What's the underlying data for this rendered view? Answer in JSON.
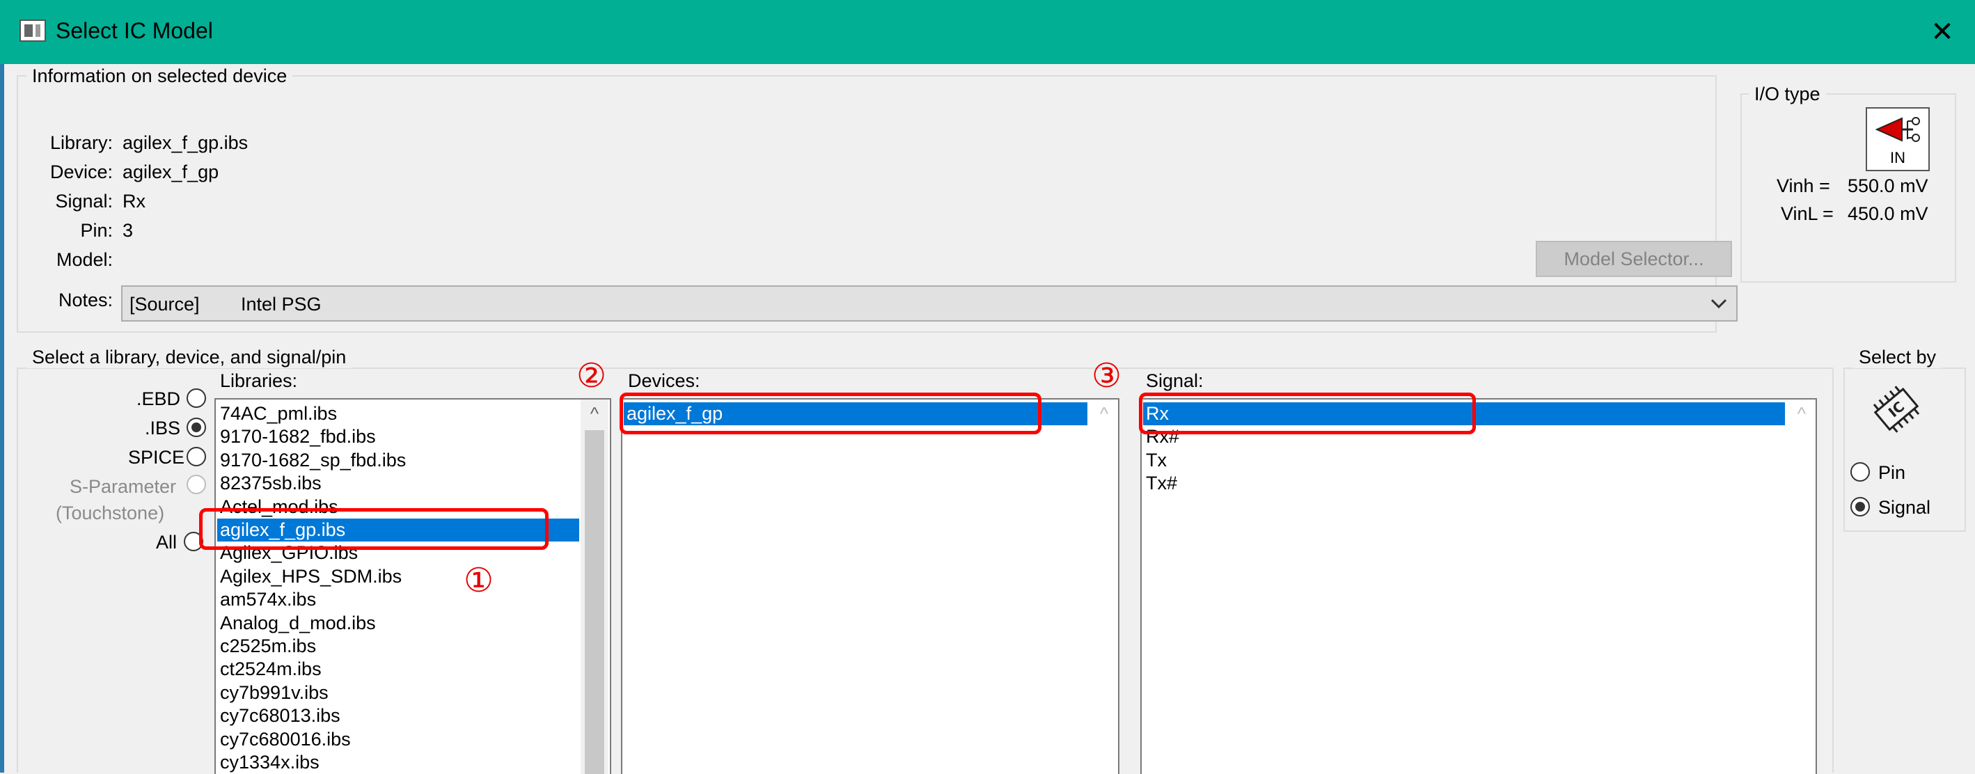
{
  "window": {
    "title": "Select IC Model",
    "close_glyph": "✕"
  },
  "info": {
    "group_title": "Information on selected device",
    "library_label": "Library:",
    "library_value": "agilex_f_gp.ibs",
    "device_label": "Device:",
    "device_value": "agilex_f_gp",
    "signal_label": "Signal:",
    "signal_value": "Rx",
    "pin_label": "Pin:",
    "pin_value": "3",
    "model_label": "Model:",
    "model_value": "",
    "notes_label": "Notes:",
    "notes_value_source": "[Source]",
    "notes_value_text": "Intel PSG",
    "model_selector_label": "Model Selector..."
  },
  "io_type": {
    "group_title": "I/O type",
    "icon_caption": "IN",
    "vinh_label": "Vinh =",
    "vinh_value": "550.0 mV",
    "vinl_label": "VinL =",
    "vinl_value": "450.0 mV"
  },
  "select": {
    "group_title": "Select a library, device, and signal/pin",
    "file_types": [
      {
        "label": ".EBD",
        "checked": false,
        "disabled": false
      },
      {
        "label": ".IBS",
        "checked": true,
        "disabled": false
      },
      {
        "label": "SPICE",
        "checked": false,
        "disabled": false
      },
      {
        "label": "S-Parameter",
        "checked": false,
        "disabled": true
      },
      {
        "label": "(Touchstone)",
        "checked": false,
        "disabled": true
      },
      {
        "label": "All",
        "checked": false,
        "disabled": false
      }
    ],
    "libraries_label": "Libraries:",
    "libraries": [
      "74AC_pml.ibs",
      "9170-1682_fbd.ibs",
      "9170-1682_sp_fbd.ibs",
      "82375sb.ibs",
      "Actel_mod.ibs",
      "agilex_f_gp.ibs",
      "Agilex_GPIO.ibs",
      "Agilex_HPS_SDM.ibs",
      "am574x.ibs",
      "Analog_d_mod.ibs",
      "c2525m.ibs",
      "ct2524m.ibs",
      "cy7b991v.ibs",
      "cy7c68013.ibs",
      "cy7c680016.ibs",
      "cy1334x.ibs"
    ],
    "libraries_selected": 5,
    "devices_label": "Devices:",
    "devices": [
      "agilex_f_gp"
    ],
    "signal_label": "Signal:",
    "signals": [
      "Rx",
      "Rx#",
      "Tx",
      "Tx#"
    ]
  },
  "select_by": {
    "group_title": "Select by",
    "icon_text": "IC",
    "pin_label": "Pin",
    "signal_label": "Signal",
    "selected": "Signal"
  },
  "annotations": {
    "step1": "①",
    "step2": "②",
    "step3": "③"
  },
  "colors": {
    "titlebar": "#00af94",
    "selection": "#0078d7",
    "callout": "#ff0000"
  }
}
